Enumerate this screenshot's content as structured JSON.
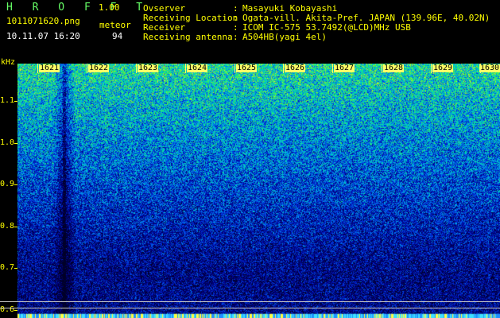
{
  "header": {
    "app_title": "H R O F F T",
    "app_version": "1.00",
    "file_name": "1011071620.png",
    "timestamp": "10.11.07 16:20",
    "meteor_label": "meteor",
    "meteor_count": "94"
  },
  "info": [
    {
      "label": "Ovserver",
      "sep": ":",
      "value": "Masayuki Kobayashi"
    },
    {
      "label": "Receiving Location",
      "sep": ":",
      "value": "Ogata-vill. Akita-Pref. JAPAN (139.96E, 40.02N)"
    },
    {
      "label": "Receiver",
      "sep": ":",
      "value": "ICOM IC-575 53.7492(@LCD)MHz USB"
    },
    {
      "label": "Receiving antenna",
      "sep": ":",
      "value": "A504HB(yagi 4el)"
    }
  ],
  "colors": {
    "text_yellow": "#ffff00",
    "text_white": "#ffffff",
    "text_green": "#66ff66",
    "background": "#000000"
  },
  "chart_data": {
    "type": "heatmap",
    "unit_label": "kHz",
    "y_ticks": [
      "1.1",
      "1.0",
      "0.9",
      "0.8",
      "0.7",
      "0.6"
    ],
    "x_ticks": [
      "1621",
      "1622",
      "1623",
      "1624",
      "1625",
      "1626",
      "1627",
      "1628",
      "1629",
      "1630"
    ],
    "ylim": [
      0.58,
      1.19
    ],
    "xlim": [
      1620.6,
      1630.4
    ],
    "reference_lines_khz": [
      0.62,
      0.605
    ],
    "meteor_echo_time": 1621.55
  }
}
